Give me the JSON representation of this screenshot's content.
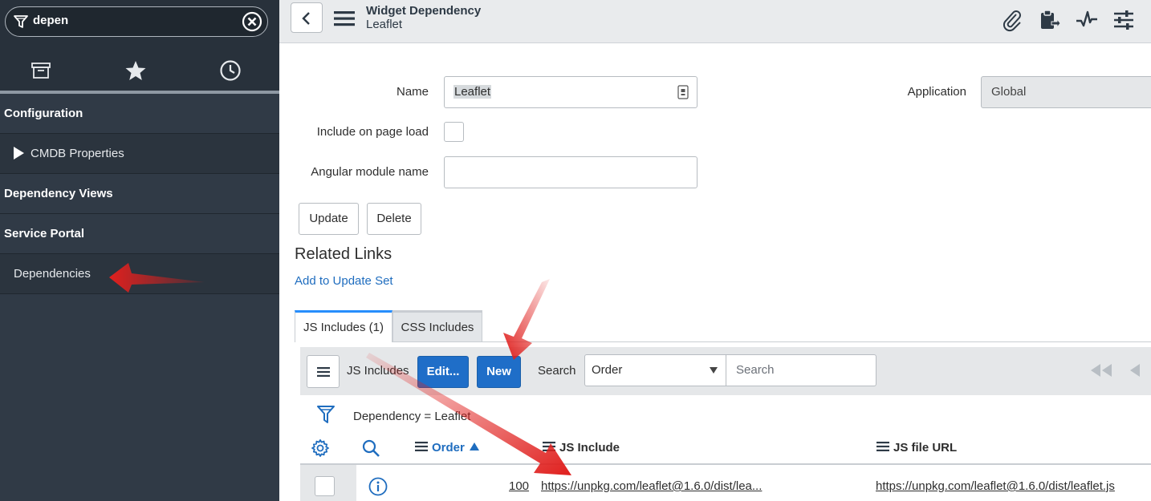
{
  "sidebar": {
    "filter": {
      "value": "depen"
    },
    "items": [
      {
        "label": "Configuration"
      },
      {
        "label": "CMDB Properties"
      },
      {
        "label": "Dependency Views"
      },
      {
        "label": "Service Portal"
      },
      {
        "label": "Dependencies"
      }
    ]
  },
  "header": {
    "title": "Widget Dependency",
    "subtitle": "Leaflet"
  },
  "form": {
    "name_label": "Name",
    "name_value": "Leaflet",
    "include_label": "Include on page load",
    "angular_label": "Angular module name",
    "angular_value": "",
    "application_label": "Application",
    "application_value": "Global",
    "update_label": "Update",
    "delete_label": "Delete"
  },
  "related": {
    "title": "Related Links",
    "add_update_set": "Add to Update Set"
  },
  "tabs": [
    {
      "label": "JS Includes (1)"
    },
    {
      "label": "CSS Includes"
    }
  ],
  "list": {
    "title": "JS Includes",
    "edit_label": "Edit...",
    "new_label": "New",
    "search_label": "Search",
    "search_field": "Order",
    "search_placeholder": "Search",
    "breadcrumb": "Dependency = Leaflet",
    "columns": [
      "Order",
      "JS Include",
      "JS file URL"
    ],
    "rows": [
      {
        "order": "100",
        "js_include": "https://unpkg.com/leaflet@1.6.0/dist/lea...",
        "js_file_url": "https://unpkg.com/leaflet@1.6.0/dist/leaflet.js"
      }
    ]
  },
  "colors": {
    "sidebar_bg": "#303a46",
    "primary_button": "#1f6ec8",
    "link": "#1f6dbf",
    "annotation_arrow": "#e0201e"
  }
}
